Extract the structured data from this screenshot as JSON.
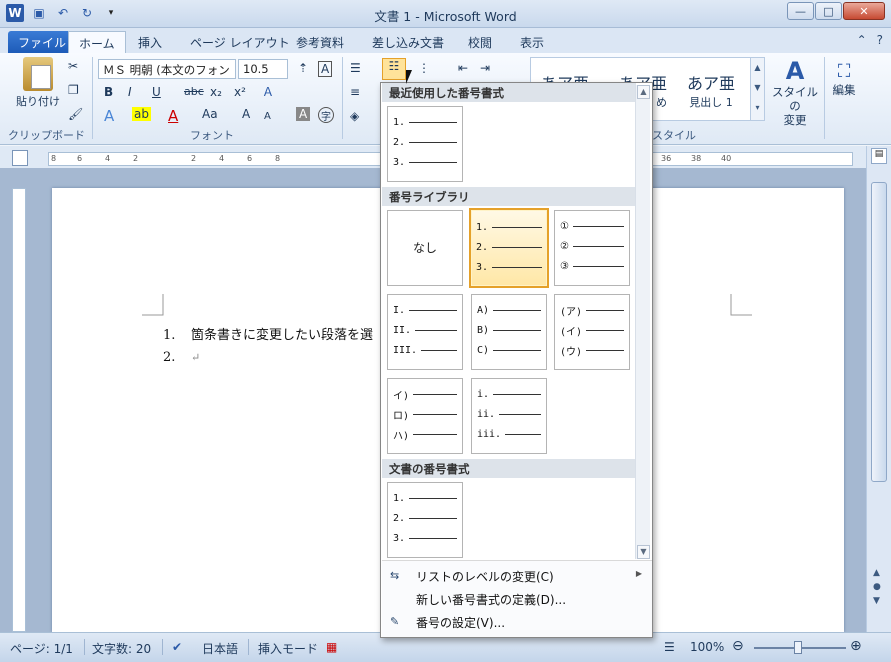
{
  "window": {
    "title": "文書 1 - Microsoft Word"
  },
  "qat": {
    "icons": [
      "word-icon",
      "save-icon",
      "undo-icon",
      "redo-icon",
      "customize-icon"
    ]
  },
  "tabs": [
    {
      "label": "ファイル"
    },
    {
      "label": "ホーム"
    },
    {
      "label": "挿入"
    },
    {
      "label": "ページ レイアウト"
    },
    {
      "label": "参考資料"
    },
    {
      "label": "差し込み文書"
    },
    {
      "label": "校閲"
    },
    {
      "label": "表示"
    }
  ],
  "ribbon": {
    "paste_label": "貼り付け",
    "clipboard_group": "クリップボード",
    "font_group": "フォント",
    "style_group": "スタイル",
    "font_name": "ＭＳ 明朝 (本文のフォン",
    "font_size": "10.5",
    "style_items": [
      {
        "sample": "あア亜",
        "name": ""
      },
      {
        "sample": "あア亜",
        "name": "め"
      },
      {
        "sample": "あア亜",
        "name": "見出し 1"
      }
    ],
    "change_styles_label": "スタイルの\n変更",
    "edit_label": "編集",
    "font_buttons": [
      "B",
      "I",
      "U",
      "abc",
      "x₂",
      "x²",
      "A",
      "Aa",
      "A",
      "A"
    ]
  },
  "ruler": {
    "ticks": [
      "8",
      "6",
      "4",
      "2",
      "2",
      "4",
      "6",
      "8",
      "36",
      "38",
      "40"
    ]
  },
  "document": {
    "lines": [
      {
        "number": "1.",
        "text": "箇条書きに変更したい段落を選"
      },
      {
        "number": "2.",
        "text": ""
      }
    ],
    "pilcrow": "↵"
  },
  "numbering_menu": {
    "recent_header": "最近使用した番号書式",
    "library_header": "番号ライブラリ",
    "document_header": "文書の番号書式",
    "none_label": "なし",
    "recent": [
      [
        "1.",
        "2.",
        "3."
      ]
    ],
    "library": [
      [
        "1.",
        "2.",
        "3."
      ],
      [
        "①",
        "②",
        "③"
      ],
      [
        "I.",
        "II.",
        "III."
      ],
      [
        "A)",
        "B)",
        "C)"
      ],
      [
        "(ア)",
        "(イ)",
        "(ウ)"
      ],
      [
        "イ)",
        "ロ)",
        "ハ)"
      ],
      [
        "i.",
        "ii.",
        "iii."
      ]
    ],
    "document_formats": [
      [
        "1.",
        "2.",
        "3."
      ]
    ],
    "commands": [
      {
        "label": "リストのレベルの変更(C)",
        "icon": "list-level-icon",
        "submenu": true
      },
      {
        "label": "新しい番号書式の定義(D)...",
        "icon": "",
        "submenu": false
      },
      {
        "label": "番号の設定(V)...",
        "icon": "set-numbering-icon",
        "submenu": false
      }
    ],
    "selected_index": 0
  },
  "status": {
    "page": "ページ: 1/1",
    "words": "文字数: 20",
    "language": "日本語",
    "mode": "挿入モード",
    "zoom": "100%"
  }
}
